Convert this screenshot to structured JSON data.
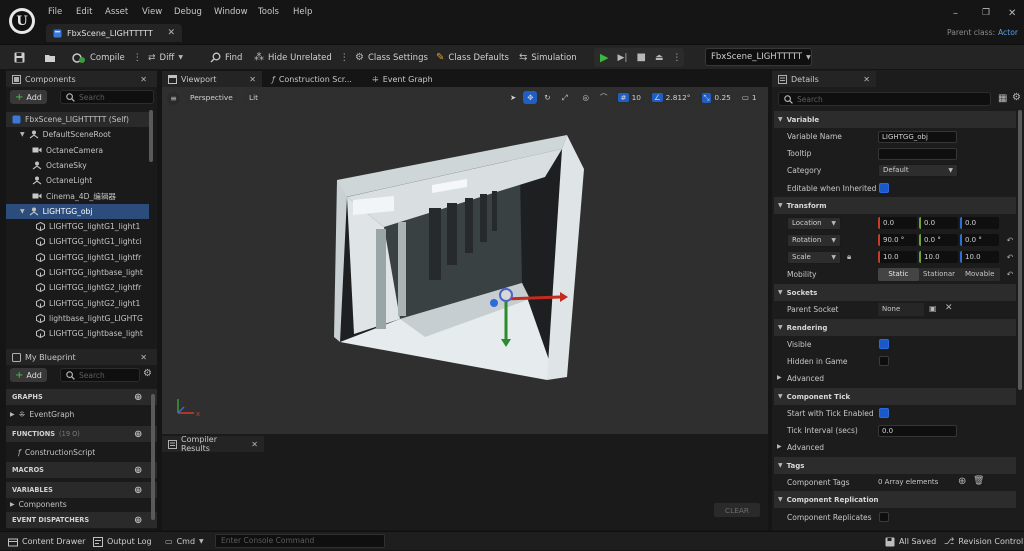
{
  "menu": [
    "File",
    "Edit",
    "Asset",
    "View",
    "Debug",
    "Window",
    "Tools",
    "Help"
  ],
  "asset_tab": "FbxScene_LIGHTTTTT",
  "parent_class": {
    "label": "Parent class:",
    "value": "Actor"
  },
  "toolbar": {
    "compile": "Compile",
    "diff": "Diff",
    "find": "Find",
    "hide_unrelated": "Hide Unrelated",
    "class_settings": "Class Settings",
    "class_defaults": "Class Defaults",
    "simulation": "Simulation",
    "debug_object": "FbxScene_LIGHTTTTT"
  },
  "components": {
    "tab": "Components",
    "add": "Add",
    "search_placeholder": "Search",
    "items": [
      {
        "label": "FbxScene_LIGHTTTTT (Self)",
        "icon": "actor-icon"
      },
      {
        "label": "DefaultSceneRoot",
        "icon": "scene-root-icon"
      },
      {
        "label": "OctaneCamera",
        "icon": "camera-icon"
      },
      {
        "label": "OctaneSky",
        "icon": "scene-root-icon"
      },
      {
        "label": "OctaneLight",
        "icon": "scene-root-icon"
      },
      {
        "label": "Cinema_4D_编辑器",
        "icon": "camera-icon"
      },
      {
        "label": "LIGHTGG_obj",
        "icon": "scene-root-icon"
      },
      {
        "label": "LIGHTGG_lightG1_light1",
        "icon": "mesh-icon"
      },
      {
        "label": "LIGHTGG_lightG1_lightci",
        "icon": "mesh-icon"
      },
      {
        "label": "LIGHTGG_lightG1_lightfr",
        "icon": "mesh-icon"
      },
      {
        "label": "LIGHTGG_lightbase_light",
        "icon": "mesh-icon"
      },
      {
        "label": "LIGHTGG_lightG2_lightfr",
        "icon": "mesh-icon"
      },
      {
        "label": "LIGHTGG_lightG2_light1",
        "icon": "mesh-icon"
      },
      {
        "label": "lightbase_lightG_LIGHTG",
        "icon": "mesh-icon"
      },
      {
        "label": "LIGHTGG_lightbase_light",
        "icon": "mesh-icon"
      }
    ]
  },
  "my_blueprint": {
    "tab": "My Blueprint",
    "add": "Add",
    "search_placeholder": "Search",
    "sections": [
      {
        "label": "GRAPHS"
      },
      {
        "label": "EventGraph"
      },
      {
        "label": "FUNCTIONS",
        "count": "(19 O)"
      },
      {
        "label": "ConstructionScript"
      },
      {
        "label": "MACROS"
      },
      {
        "label": "VARIABLES"
      },
      {
        "label": "Components"
      },
      {
        "label": "EVENT DISPATCHERS"
      }
    ]
  },
  "editor_tabs": [
    "Viewport",
    "Construction Scr...",
    "Event Graph"
  ],
  "viewport": {
    "perspective": "Perspective",
    "lit": "Lit",
    "grid_snap": "10",
    "rot_snap": "2.812°",
    "scale_snap": "0.25",
    "camera_speed": "1"
  },
  "compiler": {
    "tab": "Compiler Results",
    "clear": "CLEAR"
  },
  "details": {
    "tab": "Details",
    "search_placeholder": "Search",
    "variable_header": "Variable",
    "variable_name_label": "Variable Name",
    "variable_name": "LIGHTGG_obj",
    "tooltip_label": "Tooltip",
    "tooltip": "",
    "category_label": "Category",
    "category": "Default",
    "editable_label": "Editable when Inherited",
    "transform_header": "Transform",
    "location_label": "Location",
    "location": [
      "0.0",
      "0.0",
      "0.0"
    ],
    "rotation_label": "Rotation",
    "rotation": [
      "90.0 °",
      "0.0 °",
      "0.0 °"
    ],
    "scale_label": "Scale",
    "scale": [
      "10.0",
      "10.0",
      "10.0"
    ],
    "mobility_label": "Mobility",
    "mobility": [
      "Static",
      "Stationar",
      "Movable"
    ],
    "sockets_header": "Sockets",
    "parent_socket_label": "Parent Socket",
    "parent_socket": "None",
    "rendering_header": "Rendering",
    "visible_label": "Visible",
    "hidden_label": "Hidden in Game",
    "advanced": "Advanced",
    "tick_header": "Component Tick",
    "tick_enabled_label": "Start with Tick Enabled",
    "tick_interval_label": "Tick Interval (secs)",
    "tick_interval": "0.0",
    "advanced2": "Advanced",
    "tags_header": "Tags",
    "component_tags_label": "Component Tags",
    "component_tags": "0 Array elements",
    "replication_header": "Component Replication",
    "replicates_label": "Component Replicates"
  },
  "status": {
    "content_drawer": "Content Drawer",
    "output_log": "Output Log",
    "cmd": "Cmd",
    "console_placeholder": "Enter Console Command",
    "all_saved": "All Saved",
    "revision": "Revision Control"
  }
}
